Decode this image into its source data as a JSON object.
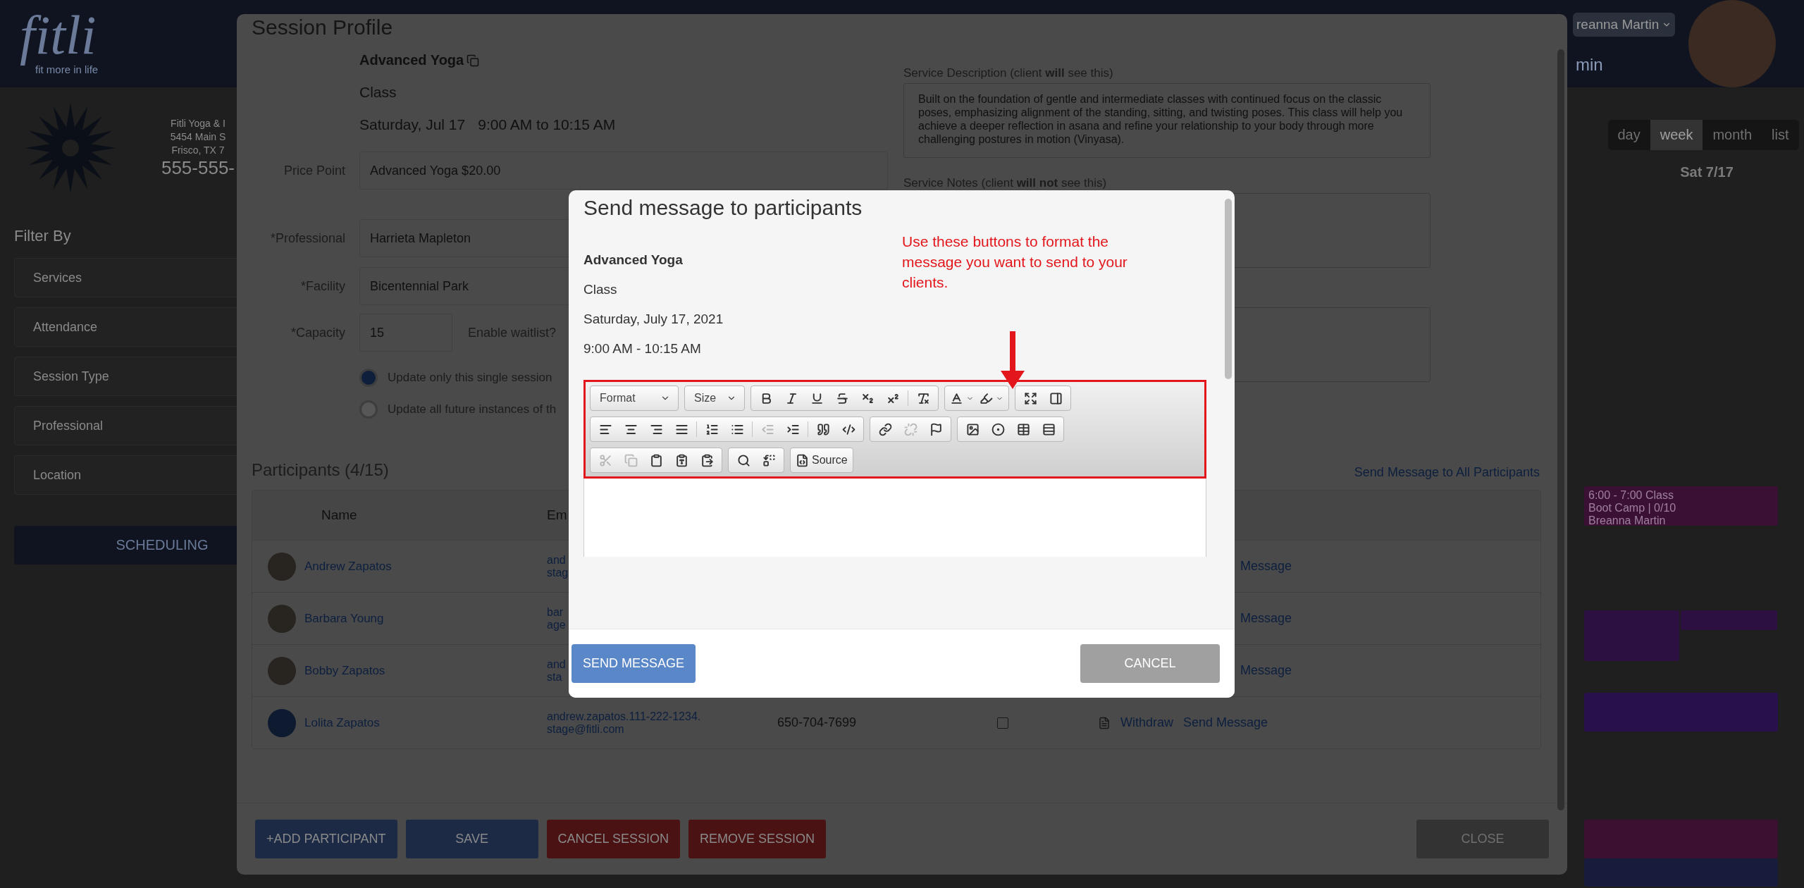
{
  "app": {
    "logo": {
      "name": "fitli",
      "tagline": "fit more in life"
    },
    "studio": {
      "lines": [
        "Fitli Yoga & I",
        "5454 Main S",
        "Frisco, TX 7"
      ],
      "phone": "555-555-"
    },
    "filter_title": "Filter By",
    "filters": [
      "Services",
      "Attendance",
      "Session Type",
      "Professional",
      "Location"
    ],
    "scheduling": "SCHEDULING",
    "user": {
      "name": "reanna Martin",
      "role": "min"
    },
    "views": [
      {
        "label": "day",
        "selected": false
      },
      {
        "label": "week",
        "selected": true
      },
      {
        "label": "month",
        "selected": false
      },
      {
        "label": "list",
        "selected": false
      }
    ],
    "calendar_date": "Sat 7/17",
    "events": [
      {
        "color": "#3a1034",
        "time": "6:00 - 7:00",
        "type": "Class",
        "title": "Boot Camp | 0/10",
        "professional": "Breanna Martin"
      },
      {
        "color": "#2c1042"
      },
      {
        "color": "#2c1042"
      },
      {
        "color": "#28104c"
      },
      {
        "color": "#3c1030"
      },
      {
        "color": "#181c3c"
      }
    ]
  },
  "session_profile": {
    "title": "Session Profile",
    "service": "Advanced Yoga",
    "type": "Class",
    "date": "Saturday, Jul 17",
    "time": "9:00 AM to 10:15 AM",
    "fields": [
      {
        "label": "Price Point",
        "value": "Advanced Yoga $20.00"
      },
      {
        "label": "*Professional",
        "value": "Harrieta Mapleton"
      },
      {
        "label": "*Facility",
        "value": "Bicentennial Park"
      }
    ],
    "capacity": {
      "label": "*Capacity",
      "value": "15"
    },
    "waitlist_label": "Enable waitlist?",
    "update_options": [
      {
        "label": "Update only this single session",
        "selected": true
      },
      {
        "label": "Update all future instances of th",
        "selected": false
      }
    ],
    "description": {
      "label": "Service Description (client **will** see this)",
      "value": "Built on the foundation of gentle and intermediate classes with continued focus on the classic poses, emphasizing alignment of the standing, sitting, and twisting poses. This class will help you achieve a deeper reflection in asana and refine your relationship to your body through more challenging postures in motion (Vinyasa)."
    },
    "notes": {
      "label": "Service Notes (client **will not** see this)"
    },
    "participants_title": "Participants (4/15)",
    "send_all": "Send Message to All Participants",
    "columns": [
      "Name",
      "Em"
    ],
    "participants": [
      {
        "name": "Andrew Zapatos",
        "email": [
          "and",
          "stag"
        ],
        "send": "Message"
      },
      {
        "name": "Barbara Young",
        "email": [
          "bar",
          "age"
        ],
        "send": "Message"
      },
      {
        "name": "Bobby Zapatos",
        "email": [
          "and",
          "sta"
        ],
        "send": "Message"
      },
      {
        "name": "Lolita Zapatos",
        "email": [
          "andrew.zapatos.111-222-1234.",
          "stage@fitli.com"
        ],
        "phone": "650-704-7699",
        "checked": false,
        "withdraw": "Withdraw",
        "send": "Send Message"
      }
    ],
    "buttons": [
      {
        "label": "+ADD PARTICIPANT",
        "kind": "primary"
      },
      {
        "label": "SAVE",
        "kind": "primary"
      },
      {
        "label": "CANCEL SESSION",
        "kind": "danger"
      },
      {
        "label": "REMOVE SESSION",
        "kind": "danger"
      }
    ],
    "close": "CLOSE"
  },
  "dialog": {
    "title": "Send message to participants",
    "service": "Advanced Yoga",
    "type": "Class",
    "date": "Saturday, July 17, 2021",
    "time": "9:00 AM - 10:15 AM",
    "annotation": "Use these buttons to format the message you want to send to your clients.",
    "toolbar": [
      [
        {
          "items": [
            {
              "kind": "combo",
              "label": "Format"
            }
          ]
        },
        {
          "items": [
            {
              "kind": "combo",
              "label": "Size"
            }
          ]
        },
        {
          "items": [
            {
              "kind": "button",
              "disabled": false
            },
            {
              "kind": "button",
              "disabled": false
            },
            {
              "kind": "button",
              "disabled": false
            },
            {
              "kind": "button",
              "disabled": false
            },
            {
              "kind": "button",
              "disabled": false
            },
            {
              "kind": "button",
              "disabled": false
            },
            {
              "kind": "separator"
            },
            {
              "kind": "button",
              "disabled": false
            }
          ]
        },
        {
          "items": [
            {
              "kind": "dropdown",
              "disabled": false
            },
            {
              "kind": "dropdown",
              "disabled": false
            }
          ]
        },
        {
          "items": [
            {
              "kind": "button",
              "disabled": false
            },
            {
              "kind": "button",
              "disabled": false
            }
          ]
        }
      ],
      [
        {
          "items": [
            {
              "kind": "button",
              "disabled": false
            },
            {
              "kind": "button",
              "disabled": false
            },
            {
              "kind": "button",
              "disabled": false
            },
            {
              "kind": "button",
              "disabled": false
            },
            {
              "kind": "separator"
            },
            {
              "kind": "button",
              "disabled": false
            },
            {
              "kind": "button",
              "disabled": false
            },
            {
              "kind": "separator"
            },
            {
              "kind": "button",
              "disabled": true
            },
            {
              "kind": "button",
              "disabled": false
            },
            {
              "kind": "separator"
            },
            {
              "kind": "button",
              "disabled": false
            },
            {
              "kind": "button",
              "disabled": false
            }
          ]
        },
        {
          "items": [
            {
              "kind": "button",
              "disabled": false
            },
            {
              "kind": "button",
              "disabled": true
            },
            {
              "kind": "button",
              "disabled": false
            }
          ]
        },
        {
          "items": [
            {
              "kind": "button",
              "disabled": false
            },
            {
              "kind": "button",
              "disabled": false
            },
            {
              "kind": "button",
              "disabled": false
            },
            {
              "kind": "button",
              "disabled": false
            }
          ]
        }
      ],
      [
        {
          "items": [
            {
              "kind": "button",
              "disabled": true
            },
            {
              "kind": "button",
              "disabled": true
            },
            {
              "kind": "button",
              "disabled": false
            },
            {
              "kind": "button",
              "disabled": false
            },
            {
              "kind": "button",
              "disabled": false
            }
          ]
        },
        {
          "items": [
            {
              "kind": "button",
              "disabled": false
            },
            {
              "kind": "button",
              "disabled": false
            }
          ]
        },
        {
          "items": [
            {
              "kind": "button",
              "label": "Source",
              "disabled": false
            }
          ]
        }
      ]
    ],
    "send": "SEND MESSAGE",
    "cancel": "CANCEL"
  }
}
